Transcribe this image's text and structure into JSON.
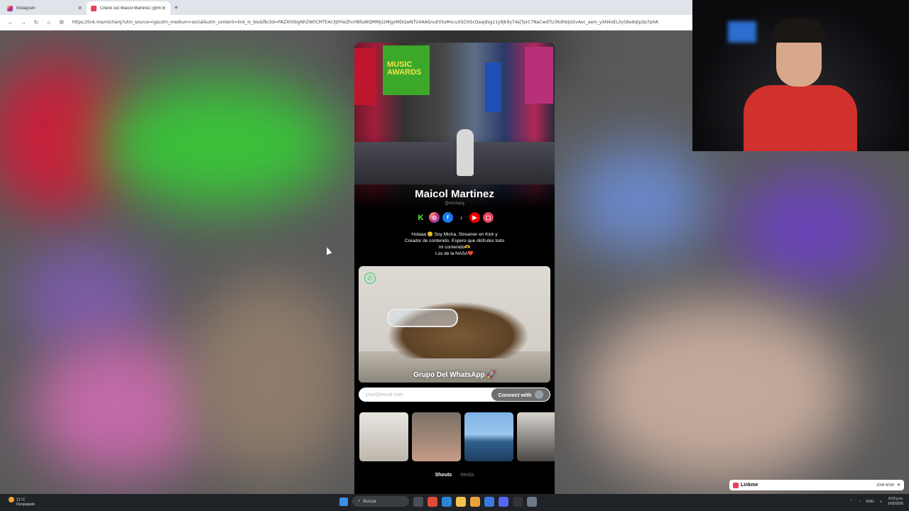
{
  "browser": {
    "tabs": [
      {
        "label": "Instagram",
        "active": false
      },
      {
        "label": "Check out Maicol Martinez (@mi",
        "active": true
      }
    ],
    "url": "https://link.me/micharg?utm_source=ig&utm_medium=social&utm_content=link_in_bio&fbclid=PAZXh0bgNhZW0CMTEAc3J0YwZhcHBfaWQMMjU2MjgxMDQwNTU4AAGnuE05sMocuXSO3GcQeaJdsg11y9jk9y74sjTprC7NaCwdTU3KdhbjUGvAoc_aem_yXN4xEL3y58a9qtp3p7pHA"
  },
  "profile": {
    "name": "Maicol Martinez",
    "handle": "@micharg",
    "bio_lines": [
      "Holaaa 😊  Soy Micha, Streamer en Kick y",
      "Creador de contenido. Espero que disfrutes todo",
      "mi contenido🫶",
      "Los de la NASA❤️"
    ],
    "socials": [
      {
        "icon": "kick-icon",
        "glyph": "K"
      },
      {
        "icon": "instagram-icon",
        "glyph": "◎"
      },
      {
        "icon": "facebook-icon",
        "glyph": "f"
      },
      {
        "icon": "tiktok-icon",
        "glyph": "♪"
      },
      {
        "icon": "youtube-icon",
        "glyph": "▶"
      },
      {
        "icon": "linkme-icon",
        "glyph": "▢"
      }
    ]
  },
  "hero": {
    "billboard": "MUSIC AWARDS"
  },
  "whatsapp_card": {
    "title": "Grupo Del WhatsApp 🚀"
  },
  "email": {
    "placeholder": "your@email.com",
    "button": "Connect with"
  },
  "sub_tabs": [
    "Shouts",
    "Media"
  ],
  "linkme_banner": {
    "brand": "Linkme",
    "cta": "JOIN NOW"
  },
  "taskbar": {
    "weather_temp": "21°C",
    "weather_desc": "Despejado",
    "search": "Buscar",
    "lang": "ENG",
    "time": "8:23 p.m.",
    "date": "1/03/2026"
  },
  "colors": {
    "whatsapp": "#25d366",
    "linkme": "#e8405b",
    "kick": "#53fc18"
  }
}
